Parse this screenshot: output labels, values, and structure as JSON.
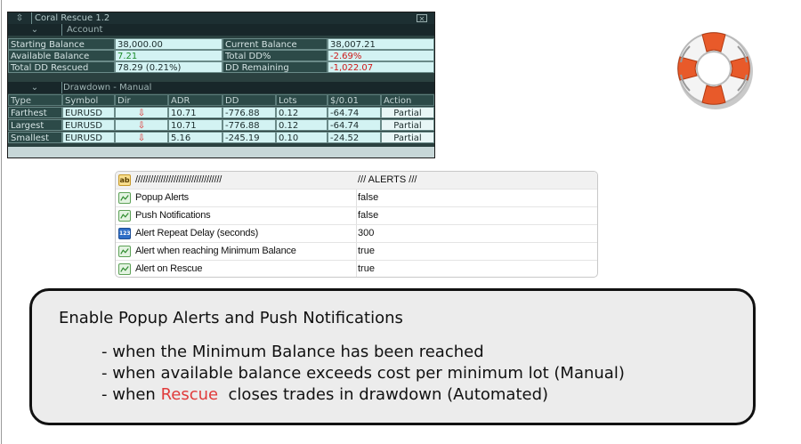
{
  "panel": {
    "title": "Coral Rescue 1.2",
    "account_header": "Account",
    "account": {
      "starting_balance_label": "Starting Balance",
      "starting_balance": "38,000.00",
      "current_balance_label": "Current Balance",
      "current_balance": "38,007.21",
      "available_balance_label": "Available Balance",
      "available_balance": "7.21",
      "total_dd_pct_label": "Total DD%",
      "total_dd_pct": "-2.69%",
      "total_dd_rescued_label": "Total DD Rescued",
      "total_dd_rescued": "78.29 (0.21%)",
      "dd_remaining_label": "DD Remaining",
      "dd_remaining": "-1,022.07"
    },
    "drawdown_header": "Drawdown - Manual",
    "columns": {
      "type": "Type",
      "symbol": "Symbol",
      "dir": "Dir",
      "adr": "ADR",
      "dd": "DD",
      "lots": "Lots",
      "per001": "$/0.01",
      "action": "Action"
    },
    "rows": [
      {
        "type": "Farthest",
        "symbol": "EURUSD",
        "dir": "⇩",
        "adr": "10.71",
        "dd": "-776.88",
        "lots": "0.12",
        "per001": "-64.74",
        "action": "Partial"
      },
      {
        "type": "Largest",
        "symbol": "EURUSD",
        "dir": "⇩",
        "adr": "10.71",
        "dd": "-776.88",
        "lots": "0.12",
        "per001": "-64.74",
        "action": "Partial"
      },
      {
        "type": "Smallest",
        "symbol": "EURUSD",
        "dir": "⇩",
        "adr": "5.16",
        "dd": "-245.19",
        "lots": "0.10",
        "per001": "-24.52",
        "action": "Partial"
      }
    ],
    "colors": {
      "positive": "#1c8c2a",
      "negative": "#d01818"
    }
  },
  "alerts": {
    "header_name": "//////////////////////////////////",
    "header_value": "/// ALERTS ///",
    "items": [
      {
        "name": "Popup Alerts",
        "value": "false",
        "icon": "bool-icon"
      },
      {
        "name": "Push Notifications",
        "value": "false",
        "icon": "bool-icon"
      },
      {
        "name": "Alert Repeat Delay (seconds)",
        "value": "300",
        "icon": "number-icon"
      },
      {
        "name": "Alert when reaching Minimum Balance",
        "value": "true",
        "icon": "bool-icon"
      },
      {
        "name": "Alert on Rescue",
        "value": "true",
        "icon": "bool-icon"
      }
    ]
  },
  "note": {
    "title": "Enable Popup Alerts and Push Notifications",
    "line1": "- when the Minimum Balance has been reached",
    "line2": "- when available balance exceeds cost per minimum lot (Manual)",
    "line3_prefix": "- when ",
    "line3_highlight": "Rescue",
    "line3_suffix": "  closes trades in drawdown (Automated)"
  }
}
